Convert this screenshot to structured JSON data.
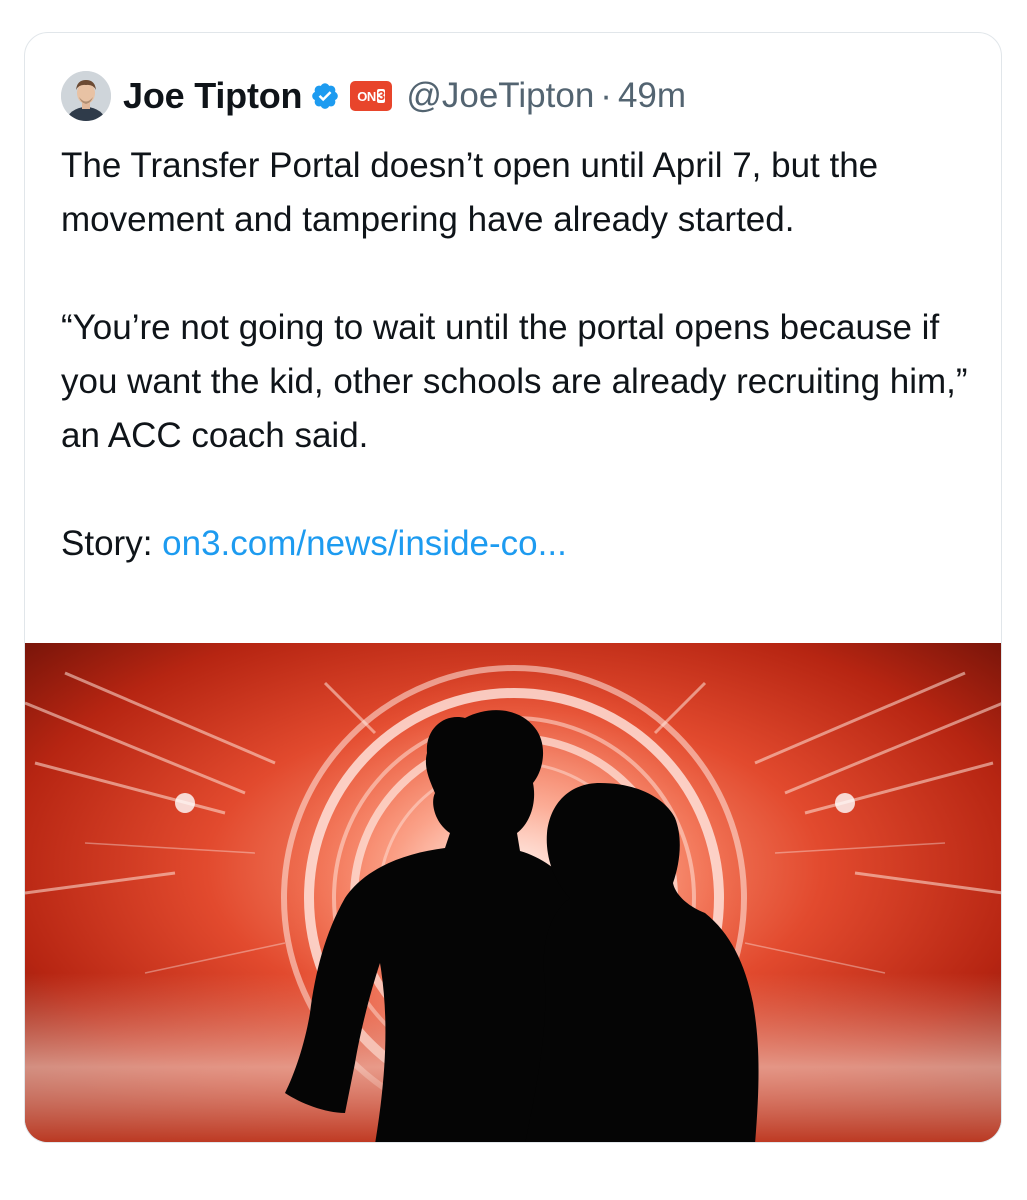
{
  "tweet": {
    "author_name": "Joe Tipton",
    "handle": "@JoeTipton",
    "separator": "·",
    "time": "49m",
    "avatar_icon": "person-avatar-icon",
    "verified_icon": "verified-badge-icon",
    "affiliation_badge": {
      "text_a": "ON",
      "text_b": "3",
      "color": "#e8452b"
    },
    "paragraphs": [
      "The Transfer Portal doesn’t open until April 7, but the movement and tampering have already started.",
      "“You’re not going to wait until the portal opens because if you want the kid, other schools are already recruiting him,” an ACC coach said."
    ],
    "story_label": "Story:",
    "story_link": "on3.com/news/inside-co...",
    "media_icon": "silhouette-portal-image",
    "colors": {
      "text": "#0f1419",
      "secondary": "#536471",
      "link": "#1d9bf0",
      "verified": "#1d9bf0",
      "media_red": "#e8452b"
    }
  }
}
